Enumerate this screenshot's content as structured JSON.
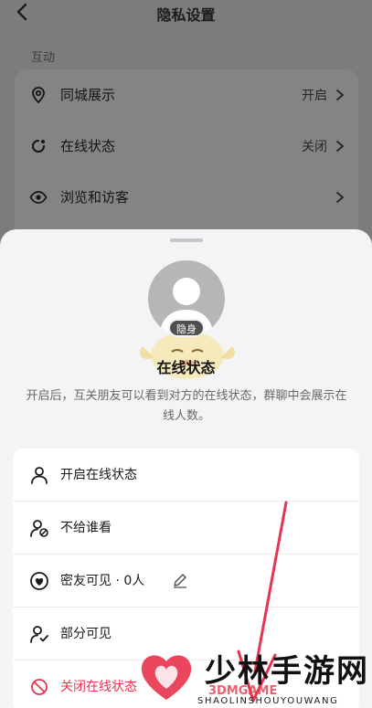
{
  "header": {
    "title": "隐私设置"
  },
  "section": {
    "label": "互动"
  },
  "settings": [
    {
      "label": "同城展示",
      "value": "开启"
    },
    {
      "label": "在线状态",
      "value": "关闭"
    },
    {
      "label": "浏览和访客",
      "value": ""
    }
  ],
  "sheet": {
    "badge": "隐身",
    "title": "在线状态",
    "description": "开启后，互关朋友可以看到对方的在线状态，群聊中会展示在线人数。",
    "options": [
      {
        "label": "开启在线状态",
        "icon": "person-icon"
      },
      {
        "label": "不给谁看",
        "icon": "person-block-icon"
      },
      {
        "label": "密友可见 · 0人",
        "icon": "heart-icon"
      },
      {
        "label": "部分可见",
        "icon": "person-check-icon"
      },
      {
        "label": "关闭在线状态",
        "icon": "block-icon"
      }
    ]
  },
  "watermark": {
    "brand_cn": "少林手游网",
    "brand_sub": "3DMGAME",
    "brand_en": "SHAOLINSHOUYOUWANG"
  },
  "colors": {
    "danger": "#e8334e",
    "annotation_arrow": "#e8334e"
  }
}
